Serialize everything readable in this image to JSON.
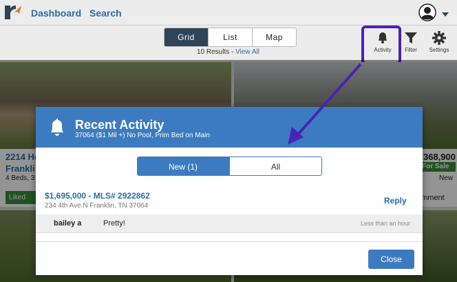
{
  "nav": {
    "links": [
      "Dashboard",
      "Search"
    ],
    "icons": [
      "logo-icon",
      "avatar-icon",
      "caret-down-icon"
    ]
  },
  "toolbar": {
    "view_tabs": [
      "Grid",
      "List",
      "Map"
    ],
    "active_view": "Grid",
    "results_text": "10 Results - ",
    "view_all": "View All",
    "tools": [
      {
        "label": "Activity",
        "icon": "bell-icon"
      },
      {
        "label": "Filter",
        "icon": "filter-icon"
      },
      {
        "label": "Settings",
        "icon": "gear-icon"
      }
    ]
  },
  "background_cards": {
    "left": {
      "title_line1": "2214 He",
      "title_line2": "Frankli",
      "details": "4 Beds, 3",
      "liked": "Liked"
    },
    "right": {
      "price": "368,900",
      "status": "For Sale",
      "tag": "New",
      "comment": "omment"
    }
  },
  "modal": {
    "title": "Recent Activity",
    "subtitle": "37064 ($1 Mil +) No Pool, Prim Bed on Main",
    "tabs": [
      "New (1)",
      "All"
    ],
    "listing": {
      "title": "$1,695,000 - MLS# 2922862",
      "address": "234 4th Ave N Franklin, TN 37064",
      "reply": "Reply"
    },
    "comment": {
      "user": "bailey a",
      "text": "Pretty!",
      "time": "Less than an hour"
    },
    "close": "Close"
  },
  "colors": {
    "brand_blue": "#3d7bc0",
    "link_blue": "#2b6ca8",
    "highlight_purple": "#4a22b6",
    "status_green": "#3a8e3a"
  }
}
